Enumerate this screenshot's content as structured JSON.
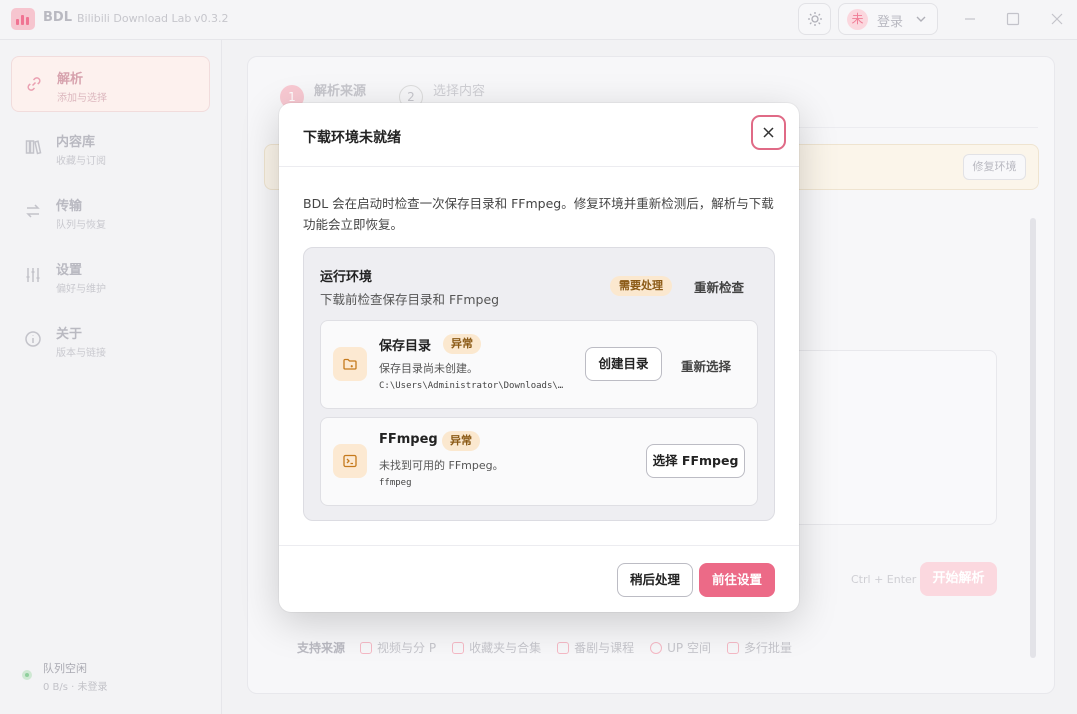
{
  "titlebar": {
    "app_name": "BDL",
    "app_full_name": "Bilibili Download Lab",
    "version": "v0.3.2",
    "avatar_char": "未",
    "login_label": "登录"
  },
  "sidebar": {
    "items": [
      {
        "title": "解析",
        "sub": "添加与选择",
        "icon": "link-icon",
        "active": true
      },
      {
        "title": "内容库",
        "sub": "收藏与订阅",
        "icon": "library-icon",
        "active": false
      },
      {
        "title": "传输",
        "sub": "队列与恢复",
        "icon": "transfer-icon",
        "active": false
      },
      {
        "title": "设置",
        "sub": "偏好与维护",
        "icon": "sliders-icon",
        "active": false
      },
      {
        "title": "关于",
        "sub": "版本与链接",
        "icon": "info-icon",
        "active": false
      }
    ],
    "queue": {
      "title": "队列空闲",
      "sub": "0 B/s · 未登录"
    }
  },
  "main": {
    "steps": [
      {
        "num": "1",
        "label": "解析来源"
      },
      {
        "num": "2",
        "label": "选择内容"
      }
    ],
    "repair_label": "修复环境",
    "shortcut": "Ctrl + Enter",
    "start_label": "开始解析",
    "sources_lead": "支持来源",
    "sources": [
      "视频与分 P",
      "收藏夹与合集",
      "番剧与课程",
      "UP 空间",
      "多行批量"
    ]
  },
  "modal": {
    "title": "下载环境未就绪",
    "description": "BDL 会在启动时检查一次保存目录和 FFmpeg。修复环境并重新检测后，解析与下载功能会立即恢复。",
    "env": {
      "title": "运行环境",
      "sub": "下载前检查保存目录和 FFmpeg",
      "badge": "需要处理",
      "recheck": "重新检查"
    },
    "items": [
      {
        "title": "保存目录",
        "badge": "异常",
        "desc": "保存目录尚未创建。",
        "path": "C:\\Users\\Administrator\\Downloads\\…",
        "primary_action": "创建目录",
        "secondary_action": "重新选择"
      },
      {
        "title": "FFmpeg",
        "badge": "异常",
        "desc": "未找到可用的 FFmpeg。",
        "path": "ffmpeg",
        "primary_action": "选择 FFmpeg"
      }
    ],
    "later_label": "稍后处理",
    "goto_label": "前往设置"
  },
  "colors": {
    "accent": "#ec6a87",
    "warning_bg": "#fbe8cf",
    "warning_text": "#8b5a16"
  }
}
